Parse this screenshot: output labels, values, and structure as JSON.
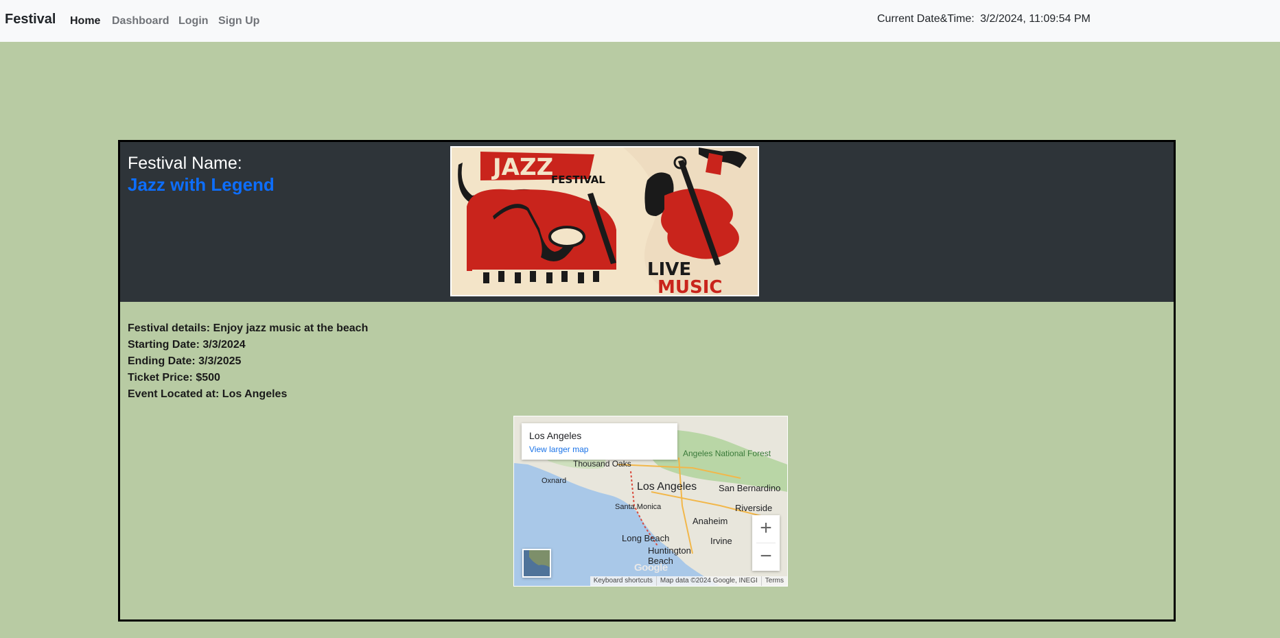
{
  "navbar": {
    "brand": "Festival",
    "links": [
      {
        "label": "Home",
        "active": true
      },
      {
        "label": "Dashboard",
        "active": false
      },
      {
        "label": "Login",
        "active": false
      },
      {
        "label": "Sign Up",
        "active": false
      }
    ],
    "datetime_label": "Current Date&Time:",
    "datetime_value": "3/2/2024, 11:09:54 PM"
  },
  "festival": {
    "name_label": "Festival Name:",
    "name": "Jazz with Legend",
    "poster": {
      "title_word_1": "JAZZ",
      "title_word_2": "FESTIVAL",
      "footer_word_1": "LIVE",
      "footer_word_2": "MUSIC"
    },
    "details": [
      "Festival details: Enjoy jazz music at the beach",
      "Starting Date: 3/3/2024",
      "Ending Date: 3/3/2025",
      "Ticket Price: $500",
      "Event Located at: Los Angeles"
    ]
  },
  "map": {
    "info_title": "Los Angeles",
    "info_link": "View larger map",
    "place_labels": [
      "Angeles National Forest",
      "Thousand Oaks",
      "Oxnard",
      "Los Angeles",
      "San Bernardino",
      "Santa Monica",
      "Riverside",
      "Anaheim",
      "Long Beach",
      "Irvine",
      "Huntington Beach"
    ],
    "zoom_in": "+",
    "zoom_out": "−",
    "logo": "Google",
    "footer": [
      "Keyboard shortcuts",
      "Map data ©2024 Google, INEGI",
      "Terms"
    ],
    "colors": {
      "water": "#a9c8e8",
      "land": "#e8e6dc",
      "forest": "#b9d6a6"
    }
  }
}
